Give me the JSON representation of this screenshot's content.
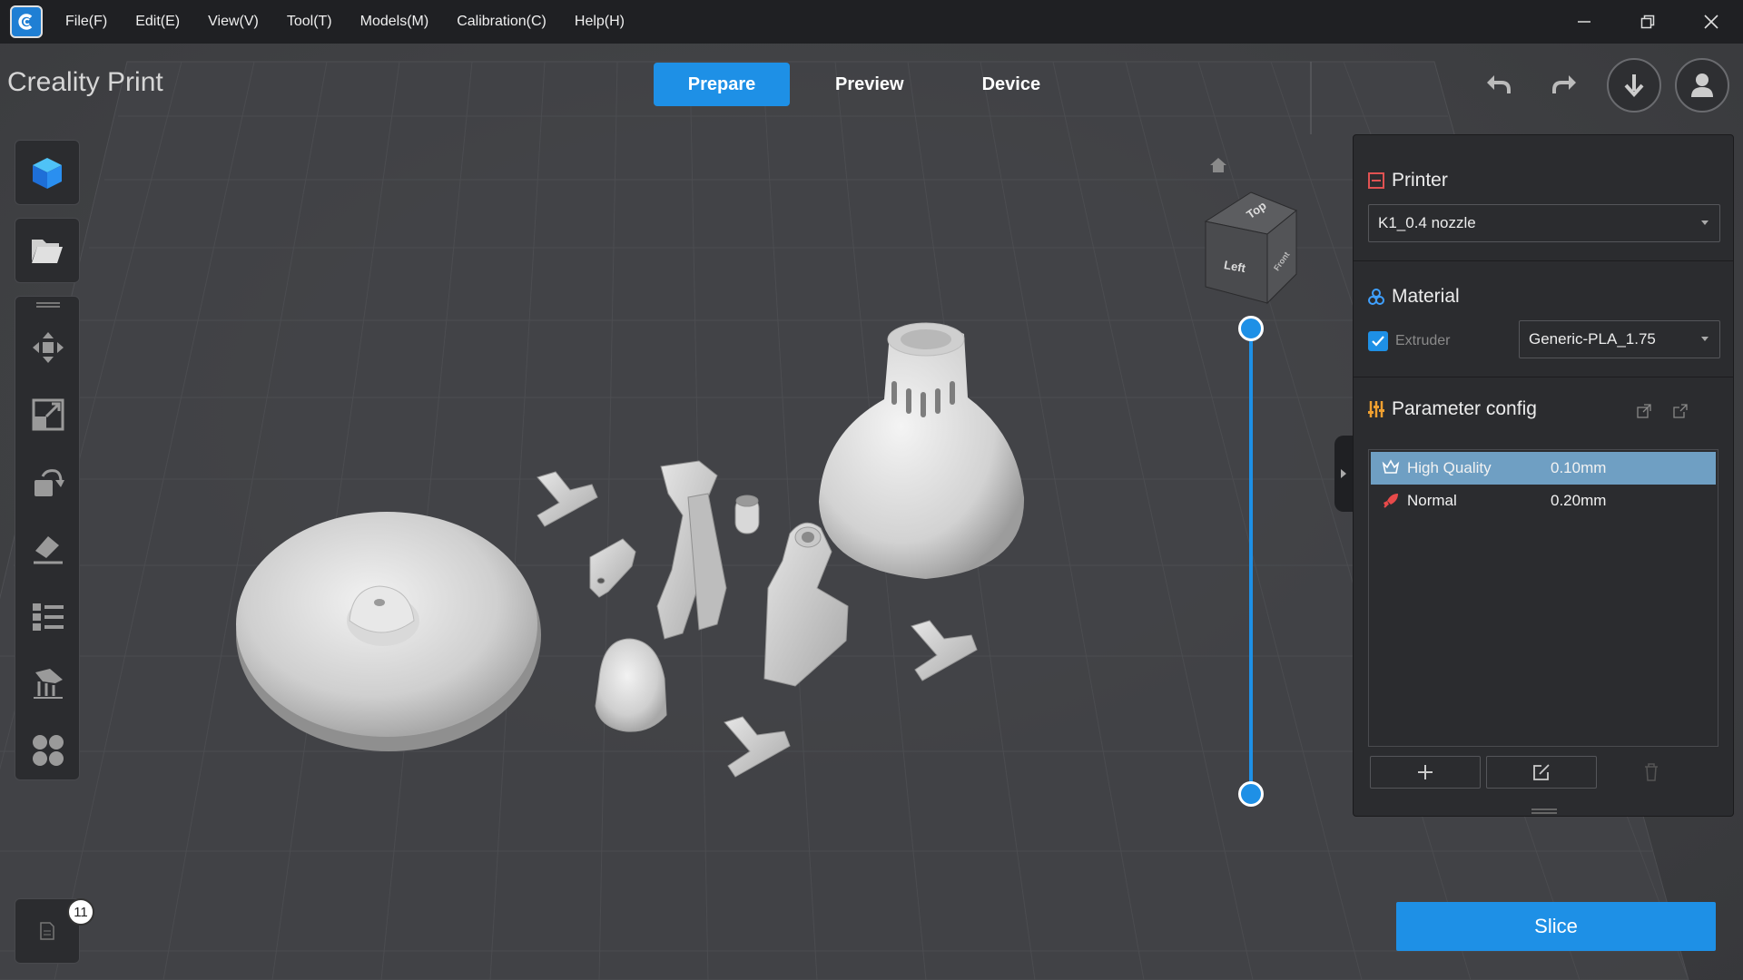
{
  "menubar": {
    "items": [
      "File(F)",
      "Edit(E)",
      "View(V)",
      "Tool(T)",
      "Models(M)",
      "Calibration(C)",
      "Help(H)"
    ],
    "controls": [
      "minimize-icon",
      "restore-icon",
      "close-icon"
    ]
  },
  "header": {
    "app_title": "Creality Print",
    "tabs": [
      {
        "label": "Prepare",
        "active": true
      },
      {
        "label": "Preview",
        "active": false
      },
      {
        "label": "Device",
        "active": false
      }
    ],
    "actions": [
      "undo-icon",
      "redo-icon",
      "download-icon",
      "user-icon"
    ]
  },
  "toolbar": {
    "top": [
      "cube-icon",
      "folder-open-icon"
    ],
    "tools": [
      "move-icon",
      "scale-icon",
      "rotate-icon",
      "lay-flat-icon",
      "object-list-icon",
      "support-icon",
      "arrange-icon"
    ]
  },
  "view_cube": {
    "faces": {
      "top": "Top",
      "left": "Left",
      "front": "Front"
    }
  },
  "right_panel": {
    "printer": {
      "title": "Printer",
      "selected": "K1_0.4 nozzle"
    },
    "material": {
      "title": "Material",
      "extruder_label": "Extruder",
      "extruder_checked": true,
      "selected": "Generic-PLA_1.75"
    },
    "params": {
      "title": "Parameter config",
      "profiles": [
        {
          "name": "High Quality",
          "value": "0.10mm",
          "icon": "crown-icon",
          "selected": true
        },
        {
          "name": "Normal",
          "value": "0.20mm",
          "icon": "rocket-icon",
          "selected": false
        }
      ]
    }
  },
  "doc_badge": "11",
  "slice_label": "Slice",
  "colors": {
    "accent": "#1e90e6",
    "background": "#3a3b3e",
    "panel": "#2b2c2f",
    "menubar": "#1f2023",
    "selected_row": "#6f9fc3"
  }
}
